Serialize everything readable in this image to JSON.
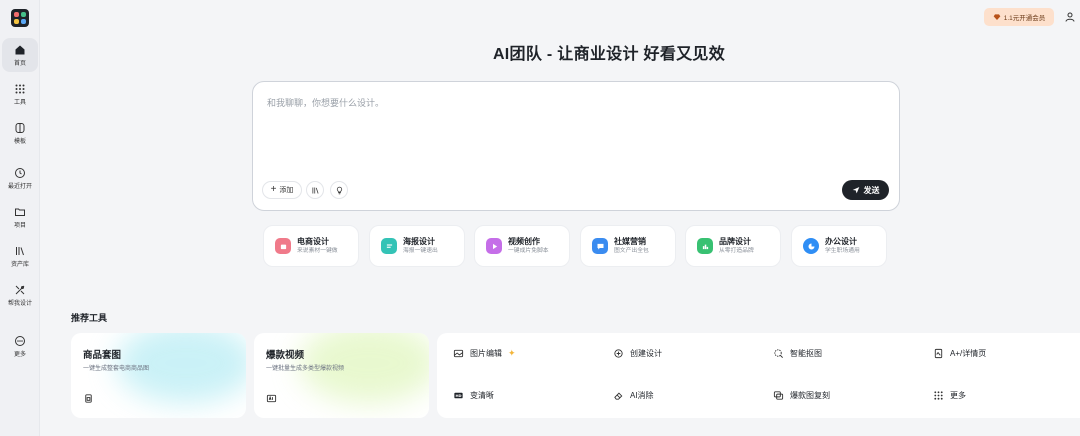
{
  "sidebar": {
    "items": [
      {
        "label": "首页",
        "icon": "home-icon",
        "active": true
      },
      {
        "label": "工具",
        "icon": "grid-dots-icon"
      },
      {
        "label": "模板",
        "icon": "template-icon"
      },
      {
        "label": "最近打开",
        "icon": "clock-icon"
      },
      {
        "label": "项目",
        "icon": "folder-icon"
      },
      {
        "label": "资产库",
        "icon": "library-icon"
      },
      {
        "label": "帮我设计",
        "icon": "magic-tools-icon"
      },
      {
        "label": "更多",
        "icon": "more-circle-icon"
      }
    ]
  },
  "header": {
    "vip_label": "1.1元开通会员",
    "title": "AI团队 - 让商业设计 好看又见效"
  },
  "chat": {
    "placeholder": "和我聊聊，你想要什么设计。",
    "add_label": "添加",
    "send_label": "发送"
  },
  "categories": [
    {
      "title": "电商设计",
      "subtitle": "来说素材一键做",
      "color": "#f07a8a"
    },
    {
      "title": "海报设计",
      "subtitle": "海报一键速出",
      "color": "#34c3b6"
    },
    {
      "title": "视频创作",
      "subtitle": "一键成片免脚本",
      "color": "#c56ee8"
    },
    {
      "title": "社媒营销",
      "subtitle": "图文产出全包",
      "color": "#3b8cf0"
    },
    {
      "title": "品牌设计",
      "subtitle": "从零打造品牌",
      "color": "#38c172"
    },
    {
      "title": "办公设计",
      "subtitle": "学生职场通用",
      "color": "#2f8ef5"
    }
  ],
  "recommend": {
    "section_title": "推荐工具",
    "promos": [
      {
        "title": "商品套图",
        "subtitle": "一键生成整套电商商品图",
        "glow": "#9fe6f0"
      },
      {
        "title": "爆款视频",
        "subtitle": "一键批量生成多类型爆款视频",
        "glow": "#d6f3a8"
      }
    ],
    "tools": [
      {
        "label": "图片编辑",
        "icon": "image-edit-icon"
      },
      {
        "label": "创建设计",
        "icon": "plus-square-icon"
      },
      {
        "label": "智能抠图",
        "icon": "smart-cutout-icon"
      },
      {
        "label": "A+/详情页",
        "icon": "detail-page-icon"
      },
      {
        "label": "变清晰",
        "icon": "hd-icon"
      },
      {
        "label": "AI消除",
        "icon": "eraser-icon"
      },
      {
        "label": "爆款图复刻",
        "icon": "replicate-icon"
      },
      {
        "label": "更多",
        "icon": "grid-dots-icon"
      }
    ]
  }
}
